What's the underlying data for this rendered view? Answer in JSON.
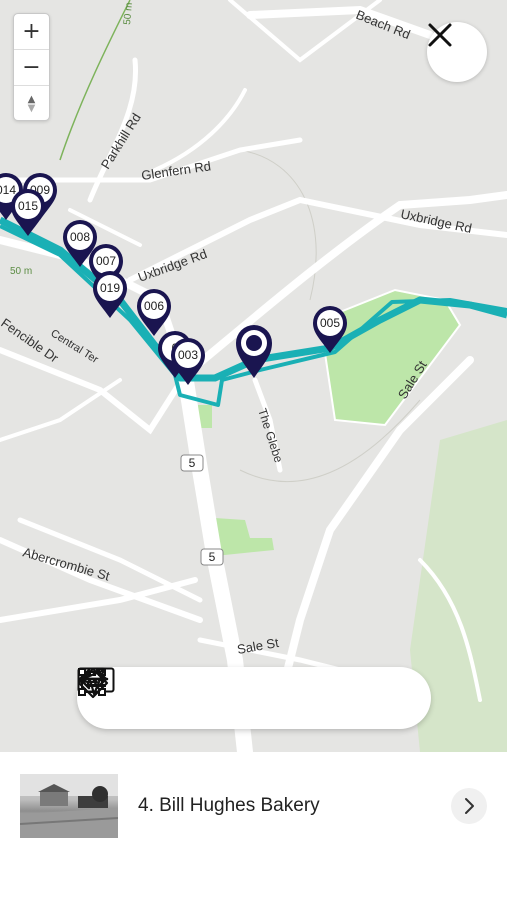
{
  "map": {
    "roads": [
      "Beach Rd",
      "Parkhill Rd",
      "Glenfern Rd",
      "Uxbridge Rd",
      "Uxbridge Rd",
      "Fencible Dr",
      "Central Ter",
      "The Glebe",
      "Sale St",
      "Abercrombie St",
      "Sale St"
    ],
    "contours": [
      "50 m",
      "50 m"
    ],
    "route_shields": [
      "5",
      "5"
    ],
    "pins": [
      "014",
      "009",
      "015",
      "008",
      "007",
      "019",
      "006",
      "0",
      "003",
      "005"
    ],
    "colors": {
      "route": "#1ab0b5",
      "pin": "#1a1550",
      "park": "#bde6a9",
      "background": "#e5e5e3"
    }
  },
  "zoom": {
    "in": "+",
    "out": "−",
    "compass": "▲▼"
  },
  "close_icon": "close-icon",
  "toolbar": {
    "icons": [
      "arrow-left-icon",
      "keyboard-icon",
      "frame-icon",
      "navigation-arrow-icon",
      "directions-icon",
      "arrow-right-icon"
    ]
  },
  "stop": {
    "title": "4. Bill Hughes Bakery",
    "thumb_icon": "historic-photo",
    "chevron_icon": "chevron-right-icon"
  }
}
